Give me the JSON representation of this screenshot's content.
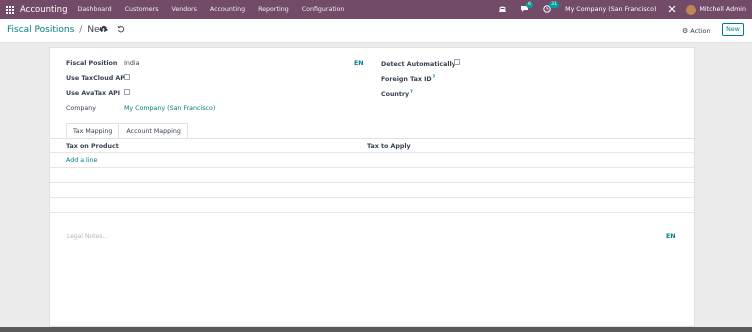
{
  "navbar": {
    "app_name": "Accounting",
    "menu": [
      "Dashboard",
      "Customers",
      "Vendors",
      "Accounting",
      "Reporting",
      "Configuration"
    ],
    "chat_badge": "6",
    "activity_badge": "31",
    "company": "My Company (San Francisco)",
    "user": "Mitchell Admin",
    "icons": [
      "apps-grid-icon",
      "phone-icon",
      "chat-icon",
      "clock-icon",
      "tools-icon"
    ]
  },
  "control_panel": {
    "breadcrumb_parent": "Fiscal Positions",
    "breadcrumb_separator": "/",
    "breadcrumb_current": "New",
    "action_label": "Action",
    "new_label": "New"
  },
  "form": {
    "fiscal_position_label": "Fiscal Position",
    "fiscal_position_value": "India",
    "lang_badge": "EN",
    "use_taxcloud_label": "Use TaxCloud API",
    "use_avatax_label": "Use AvaTax API",
    "company_label": "Company",
    "company_value": "My Company (San Francisco)",
    "detect_auto_label": "Detect Automatically",
    "foreign_tax_label": "Foreign Tax ID",
    "country_label": "Country",
    "help_mark": "?"
  },
  "tabs": [
    "Tax Mapping",
    "Account Mapping"
  ],
  "tax_table": {
    "columns": [
      "Tax on Product",
      "Tax to Apply"
    ],
    "add_line": "Add a line"
  },
  "notes": {
    "placeholder": "Legal Notes...",
    "lang_badge": "EN"
  },
  "colors": {
    "navbar": "#714b67",
    "accent": "#017e84"
  }
}
